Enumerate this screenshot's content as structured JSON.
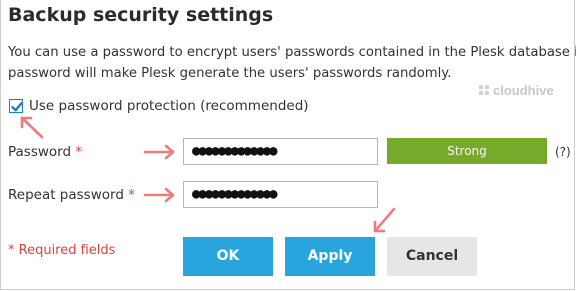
{
  "dialog": {
    "title": "Backup security settings",
    "description_line1": "You can use a password to encrypt users' passwords contained in the Plesk database in",
    "description_line2": "password will make Plesk generate the users' passwords randomly."
  },
  "watermark": {
    "text": "cloudhive"
  },
  "protection": {
    "label": "Use password protection (recommended)",
    "checked": true
  },
  "password": {
    "label": "Password",
    "required_mark": "*",
    "value": "●●●●●●●●●●●●●",
    "strength": "Strong",
    "help": "(?)"
  },
  "repeat_password": {
    "label": "Repeat password",
    "required_mark": "*",
    "value": "●●●●●●●●●●●●●"
  },
  "footer": {
    "required_note": "* Required fields",
    "ok": "OK",
    "apply": "Apply",
    "cancel": "Cancel"
  },
  "colors": {
    "accent": "#28a5dc",
    "strength_strong": "#77aa2a",
    "required": "#e33e3e",
    "annotation_arrow": "#f07a7a"
  },
  "icons": {
    "checkbox": "checkmark-icon",
    "watermark": "cloudhive-logo-icon",
    "annotation": "arrow-icon"
  }
}
